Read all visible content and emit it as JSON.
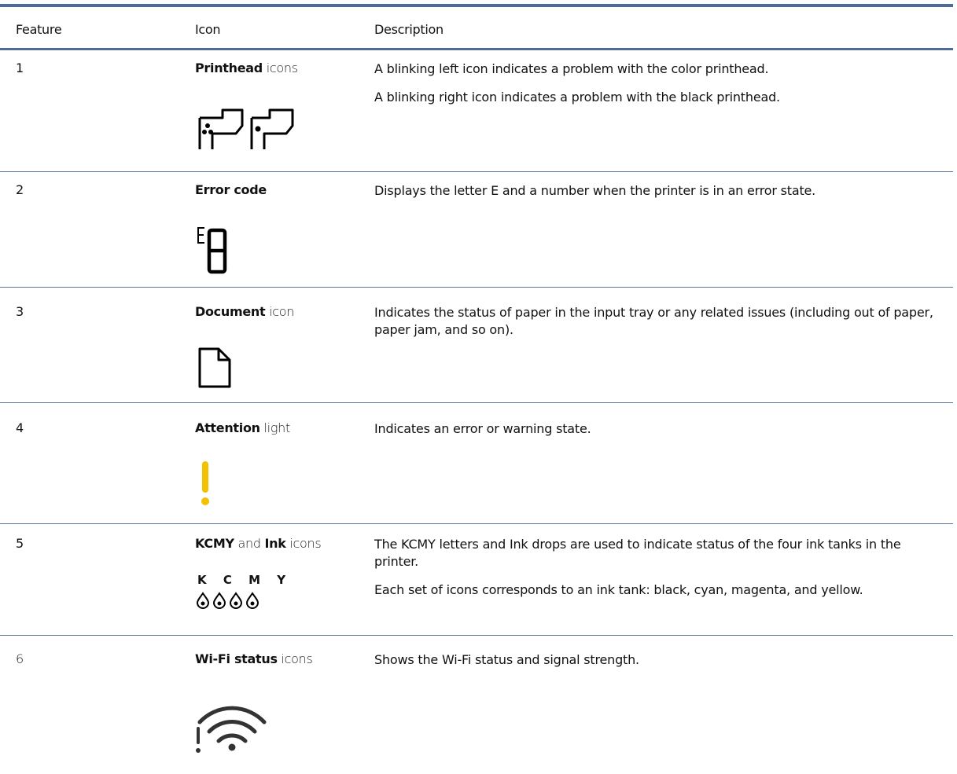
{
  "table": {
    "headers": {
      "feature": "Feature",
      "icon": "Icon",
      "description": "Description"
    },
    "rows": [
      {
        "num": "1",
        "label_bold": "Printhead",
        "label_rest": " icons",
        "desc": [
          "A blinking left icon indicates a problem with the color printhead.",
          "A blinking right icon indicates a problem with the black printhead."
        ],
        "icon": "printhead-icons"
      },
      {
        "num": "2",
        "label_bold": "Error code",
        "label_rest": "",
        "desc": [
          "Displays the letter E and a number when the printer is in an error state."
        ],
        "icon": "error-code-icon"
      },
      {
        "num": "3",
        "label_bold": "Document",
        "label_rest": " icon",
        "desc": [
          "Indicates the status of paper in the input tray or any related issues (including out of paper, paper jam, and so on)."
        ],
        "icon": "document-icon"
      },
      {
        "num": "4",
        "label_bold": "Attention",
        "label_rest": " light",
        "desc": [
          "Indicates an error or warning state."
        ],
        "icon": "attention-icon",
        "icon_color": "#f2c200"
      },
      {
        "num": "5",
        "label_bold": "KCMY",
        "label_mid": " and ",
        "label_bold2": "Ink",
        "label_rest": " icons",
        "kcmy_letters": "K C M Y",
        "desc": [
          "The KCMY letters and Ink drops are used to indicate status of the four ink tanks in the printer.",
          "Each set of icons corresponds to an ink tank: black, cyan, magenta, and yellow."
        ],
        "icon": "ink-drop-icons"
      },
      {
        "num": "6",
        "label_bold": "Wi-Fi status",
        "label_rest": " icons",
        "desc": [
          "Shows the Wi-Fi status and signal strength."
        ],
        "icon": "wifi-status-icon"
      }
    ]
  },
  "colors": {
    "rule": "#4f6b9b",
    "attention": "#f2c200"
  }
}
